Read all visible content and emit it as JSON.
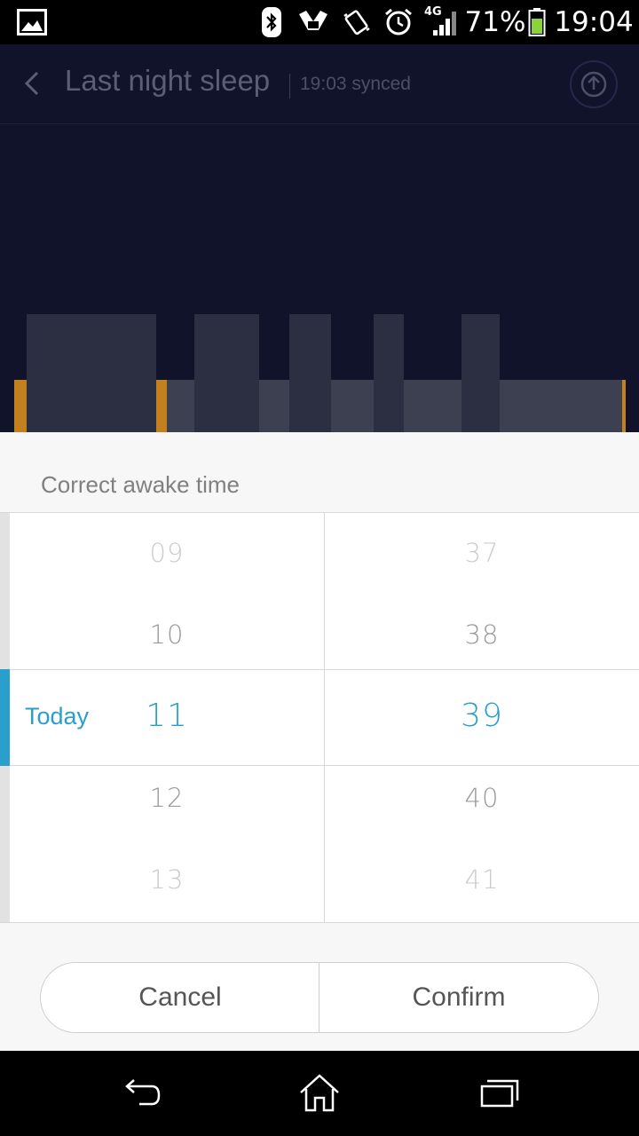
{
  "status_bar": {
    "network": "4G",
    "battery": "71%",
    "time": "19:04",
    "icons": [
      "gallery-icon",
      "bluetooth-icon",
      "mi-band-icon",
      "vibrate-icon",
      "alarm-icon",
      "signal-icon",
      "battery-icon"
    ]
  },
  "header": {
    "title": "Last night sleep",
    "sync_status": "19:03 synced",
    "back_icon": "chevron-left-icon",
    "share_icon": "upload-icon"
  },
  "sleep_chart": {
    "colors": {
      "deep": "#2b2f41",
      "light": "#3d4050",
      "awake": "#c3801f",
      "background": "#11132a"
    }
  },
  "dialog": {
    "title": "Correct awake time",
    "day_label": "Today",
    "hours": [
      "09",
      "10",
      "11",
      "12",
      "13"
    ],
    "minutes": [
      "37",
      "38",
      "39",
      "40",
      "41"
    ],
    "selected_hour": "11",
    "selected_minute": "39",
    "accent_color": "#2a9fcb",
    "cancel_label": "Cancel",
    "confirm_label": "Confirm"
  },
  "nav_bar": {
    "icons": [
      "back-icon",
      "home-icon",
      "recents-icon"
    ]
  }
}
